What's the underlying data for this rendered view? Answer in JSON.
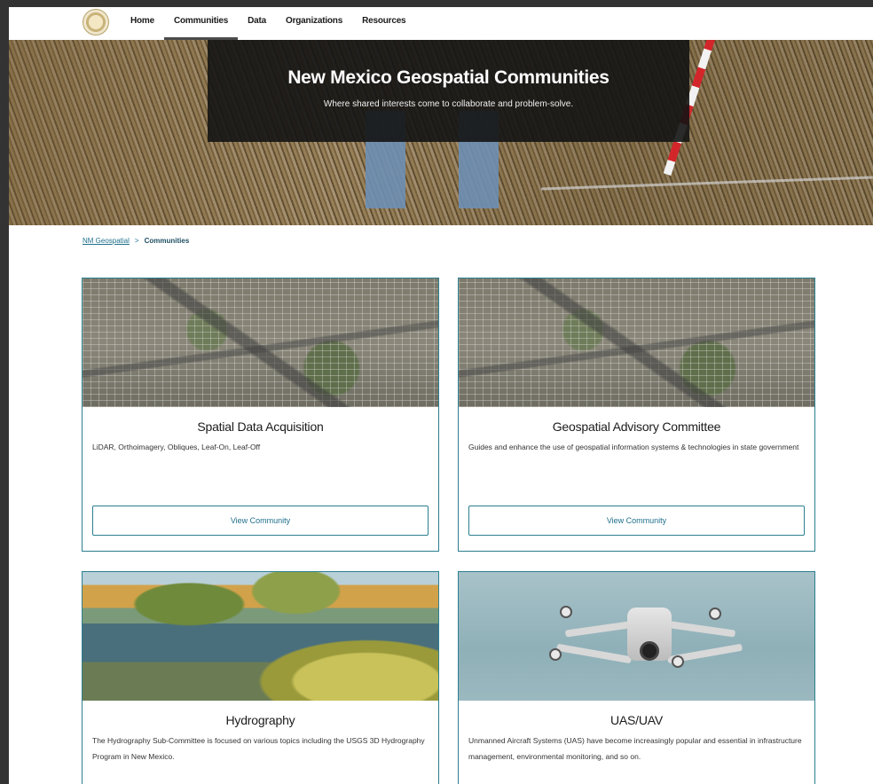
{
  "nav": {
    "logo": "state-seal-logo",
    "items": [
      {
        "label": "Home",
        "active": false
      },
      {
        "label": "Communities",
        "active": true
      },
      {
        "label": "Data",
        "active": false
      },
      {
        "label": "Organizations",
        "active": false
      },
      {
        "label": "Resources",
        "active": false
      }
    ]
  },
  "hero": {
    "title": "New Mexico Geospatial Communities",
    "subtitle": "Where shared interests come to collaborate and problem-solve."
  },
  "breadcrumb": {
    "home": "NM Geospatial",
    "separator": ">",
    "current": "Communities"
  },
  "cards": [
    {
      "title": "Spatial Data Acquisition",
      "description": "LiDAR, Orthoimagery, Obliques, Leaf-On, Leaf-Off",
      "button": "View Community",
      "image": "aerial-city-image"
    },
    {
      "title": "Geospatial Advisory Committee",
      "description": "Guides and enhance the use of geospatial information systems & technologies in state government",
      "button": "View Community",
      "image": "aerial-city-image"
    },
    {
      "title": "Hydrography",
      "description": "The Hydrography Sub-Committee is focused on various topics including the USGS 3D Hydrography Program in New Mexico.",
      "image": "river-yucca-image"
    },
    {
      "title": "UAS/UAV",
      "description": "Unmanned Aircraft Systems (UAS) have become increasingly popular and essential in infrastructure management, environmental monitoring, and so on.",
      "image": "drone-image"
    }
  ],
  "colors": {
    "accent": "#2b7f8f",
    "link": "#1f6f8b",
    "hero_overlay": "#141414"
  }
}
